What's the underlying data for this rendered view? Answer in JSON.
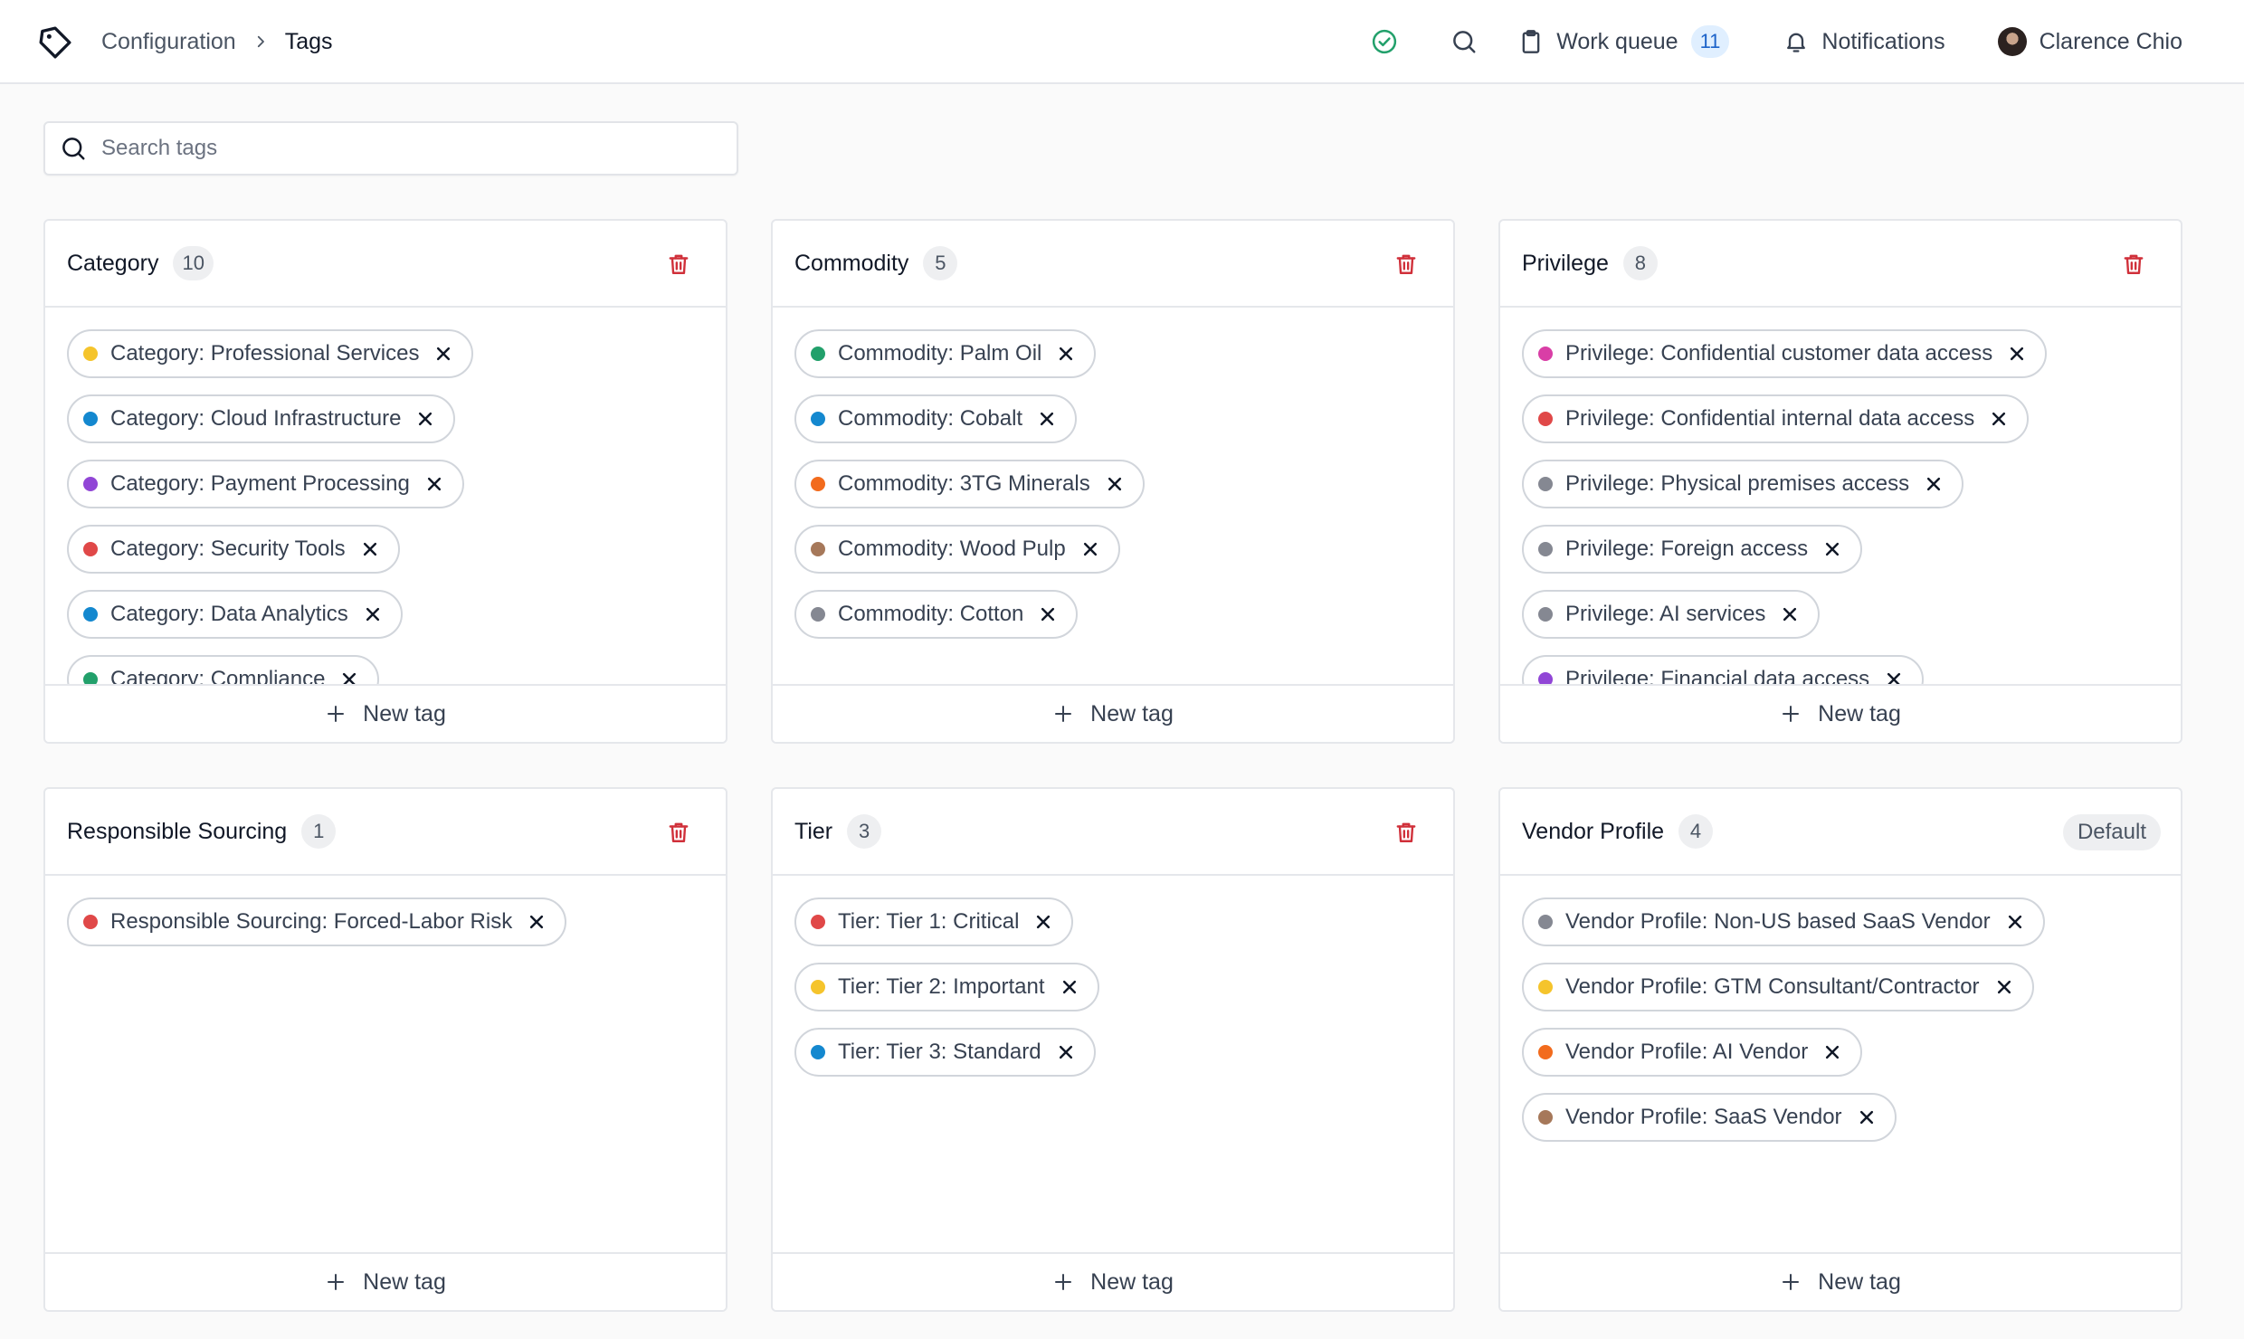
{
  "header": {
    "breadcrumb_parent": "Configuration",
    "breadcrumb_current": "Tags",
    "work_queue_label": "Work queue",
    "work_queue_count": "11",
    "notifications_label": "Notifications",
    "user_name": "Clarence Chio"
  },
  "search": {
    "placeholder": "Search tags",
    "value": ""
  },
  "new_tag_label": "New tag",
  "colors": {
    "yellow": "#f5c42c",
    "blue": "#1488cf",
    "purple": "#9146d6",
    "red": "#e04848",
    "green": "#22a06b",
    "orange": "#f26b1d",
    "brown": "#a6785a",
    "gray": "#858892",
    "magenta": "#d93ea6",
    "trash": "#d0303a",
    "check": "#22a06b"
  },
  "groups": [
    {
      "title": "Category",
      "count": "10",
      "deletable": true,
      "default_label": "",
      "tags": [
        {
          "label": "Category: Professional Services",
          "color": "yellow"
        },
        {
          "label": "Category: Cloud Infrastructure",
          "color": "blue"
        },
        {
          "label": "Category: Payment Processing",
          "color": "purple"
        },
        {
          "label": "Category: Security Tools",
          "color": "red"
        },
        {
          "label": "Category: Data Analytics",
          "color": "blue"
        },
        {
          "label": "Category: Compliance",
          "color": "green"
        }
      ]
    },
    {
      "title": "Commodity",
      "count": "5",
      "deletable": true,
      "default_label": "",
      "tags": [
        {
          "label": "Commodity: Palm Oil",
          "color": "green"
        },
        {
          "label": "Commodity: Cobalt",
          "color": "blue"
        },
        {
          "label": "Commodity: 3TG Minerals",
          "color": "orange"
        },
        {
          "label": "Commodity: Wood Pulp",
          "color": "brown"
        },
        {
          "label": "Commodity: Cotton",
          "color": "gray"
        }
      ]
    },
    {
      "title": "Privilege",
      "count": "8",
      "deletable": true,
      "default_label": "",
      "tags": [
        {
          "label": "Privilege: Confidential customer data access",
          "color": "magenta"
        },
        {
          "label": "Privilege: Confidential internal data access",
          "color": "red"
        },
        {
          "label": "Privilege: Physical premises access",
          "color": "gray"
        },
        {
          "label": "Privilege: Foreign access",
          "color": "gray"
        },
        {
          "label": "Privilege: AI services",
          "color": "gray"
        },
        {
          "label": "Privilege: Financial data access",
          "color": "purple"
        }
      ]
    },
    {
      "title": "Responsible Sourcing",
      "count": "1",
      "deletable": true,
      "default_label": "",
      "tags": [
        {
          "label": "Responsible Sourcing: Forced-Labor Risk",
          "color": "red"
        }
      ]
    },
    {
      "title": "Tier",
      "count": "3",
      "deletable": true,
      "default_label": "",
      "tags": [
        {
          "label": "Tier: Tier 1: Critical",
          "color": "red"
        },
        {
          "label": "Tier: Tier 2: Important",
          "color": "yellow"
        },
        {
          "label": "Tier: Tier 3: Standard",
          "color": "blue"
        }
      ]
    },
    {
      "title": "Vendor Profile",
      "count": "4",
      "deletable": false,
      "default_label": "Default",
      "tags": [
        {
          "label": "Vendor Profile: Non-US based SaaS Vendor",
          "color": "gray"
        },
        {
          "label": "Vendor Profile: GTM Consultant/Contractor",
          "color": "yellow"
        },
        {
          "label": "Vendor Profile: AI Vendor",
          "color": "orange"
        },
        {
          "label": "Vendor Profile: SaaS Vendor",
          "color": "brown"
        }
      ]
    }
  ]
}
